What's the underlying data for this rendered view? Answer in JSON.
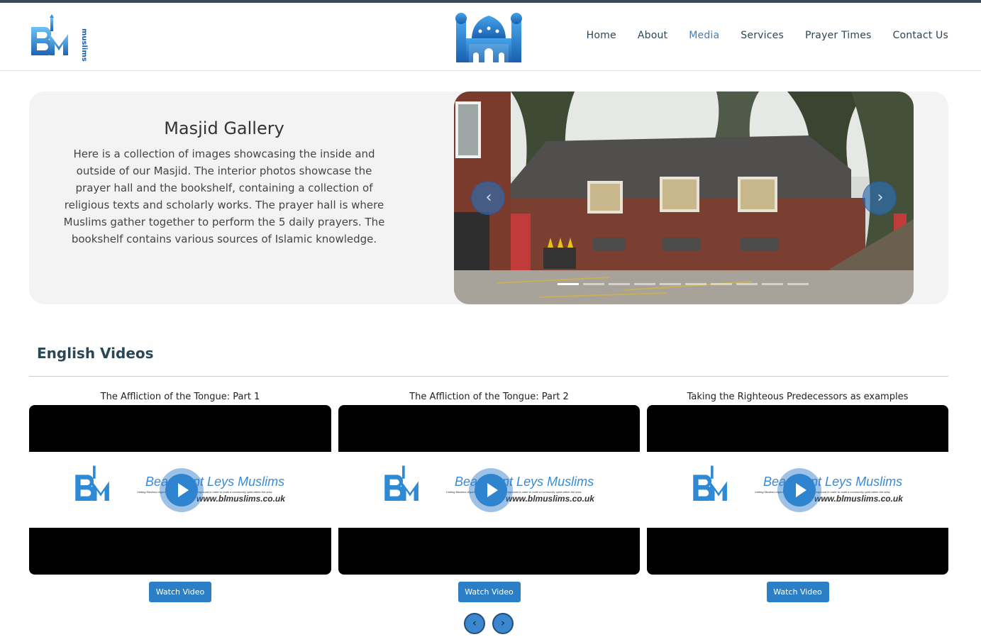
{
  "header": {
    "nav": [
      {
        "label": "Home",
        "active": false
      },
      {
        "label": "About",
        "active": false
      },
      {
        "label": "Media",
        "active": true
      },
      {
        "label": "Services",
        "active": false
      },
      {
        "label": "Prayer Times",
        "active": false
      },
      {
        "label": "Contact Us",
        "active": false
      }
    ],
    "logo_text": "muslims"
  },
  "gallery": {
    "title": "Masjid Gallery",
    "description": "Here is a collection of images showcasing the inside and outside of our Masjid. The interior photos showcase the prayer hall and the bookshelf, containing a collection of religious texts and scholarly works. The prayer hall is where Muslims gather together to perform the 5 daily prayers. The bookshelf contains various sources of Islamic knowledge.",
    "slide_count": 10,
    "active_slide": 1,
    "prev_icon": "chevron-left-icon",
    "next_icon": "chevron-right-icon"
  },
  "videos_section": {
    "title": "English Videos",
    "videos": [
      {
        "title": "The Affliction of the Tongue: Part 1",
        "button": "Watch Video",
        "thumb_brand": "Beaumont Leys Muslims",
        "thumb_url": "www.blmuslims.co.uk"
      },
      {
        "title": "The Affliction of the Tongue: Part 2",
        "button": "Watch Video",
        "thumb_brand": "Beaumont Leys Muslims",
        "thumb_url": "www.blmuslims.co.uk"
      },
      {
        "title": "Taking the Righteous Predecessors as examples",
        "button": "Watch Video",
        "thumb_brand": "Beaumont Leys Muslims",
        "thumb_url": "www.blmuslims.co.uk"
      }
    ],
    "thumb_tagline": "Uniting Muslims regardless of their culture or background in order to build a community spirit within the area."
  },
  "colors": {
    "accent": "#2b7fc6",
    "nav_text": "#2d4656",
    "nav_active": "#3a7fc1",
    "top_bar": "#3a4a57"
  }
}
